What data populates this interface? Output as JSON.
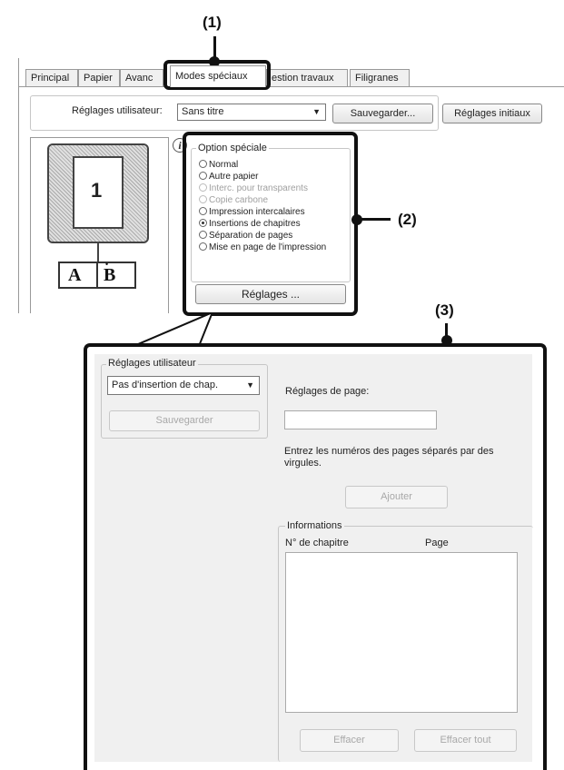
{
  "callouts": {
    "c1": "(1)",
    "c2": "(2)",
    "c3": "(3)"
  },
  "tabs": [
    {
      "label": "Principal"
    },
    {
      "label": "Papier"
    },
    {
      "label": "Avanc"
    },
    {
      "label": "Modes spéciaux"
    },
    {
      "label": "estion travaux"
    },
    {
      "label": "Filigranes"
    }
  ],
  "top_dialog": {
    "user_settings_label": "Réglages utilisateur:",
    "user_settings_value": "Sans titre",
    "save_button": "Sauvegarder...",
    "initial_settings_button": "Réglages initiaux",
    "preview_page_number": "1",
    "preview_letters": [
      "A",
      "B"
    ],
    "info_icon": "i",
    "special_option_title": "Option spéciale",
    "options": [
      {
        "label": "Normal",
        "enabled": true,
        "checked": false
      },
      {
        "label": "Autre papier",
        "enabled": true,
        "checked": false
      },
      {
        "label": "Interc. pour transparents",
        "enabled": false,
        "checked": false
      },
      {
        "label": "Copie carbone",
        "enabled": false,
        "checked": false
      },
      {
        "label": "Impression intercalaires",
        "enabled": true,
        "checked": false
      },
      {
        "label": "Insertions de chapitres",
        "enabled": true,
        "checked": true
      },
      {
        "label": "Séparation de pages",
        "enabled": true,
        "checked": false
      },
      {
        "label": "Mise en page de l'impression",
        "enabled": true,
        "checked": false
      }
    ],
    "settings_button": "Réglages ..."
  },
  "sub_dialog": {
    "user_settings_group_title": "Réglages utilisateur",
    "user_settings_value": "Pas d'insertion de chap.",
    "save_button": "Sauvegarder",
    "page_settings_label": "Réglages de page:",
    "page_input_value": "",
    "help_text": "Entrez les numéros des pages séparés par des virgules.",
    "add_button": "Ajouter",
    "info_group_title": "Informations",
    "col_chapter": "N° de chapitre",
    "col_page": "Page",
    "delete_button": "Effacer",
    "delete_all_button": "Effacer tout"
  }
}
